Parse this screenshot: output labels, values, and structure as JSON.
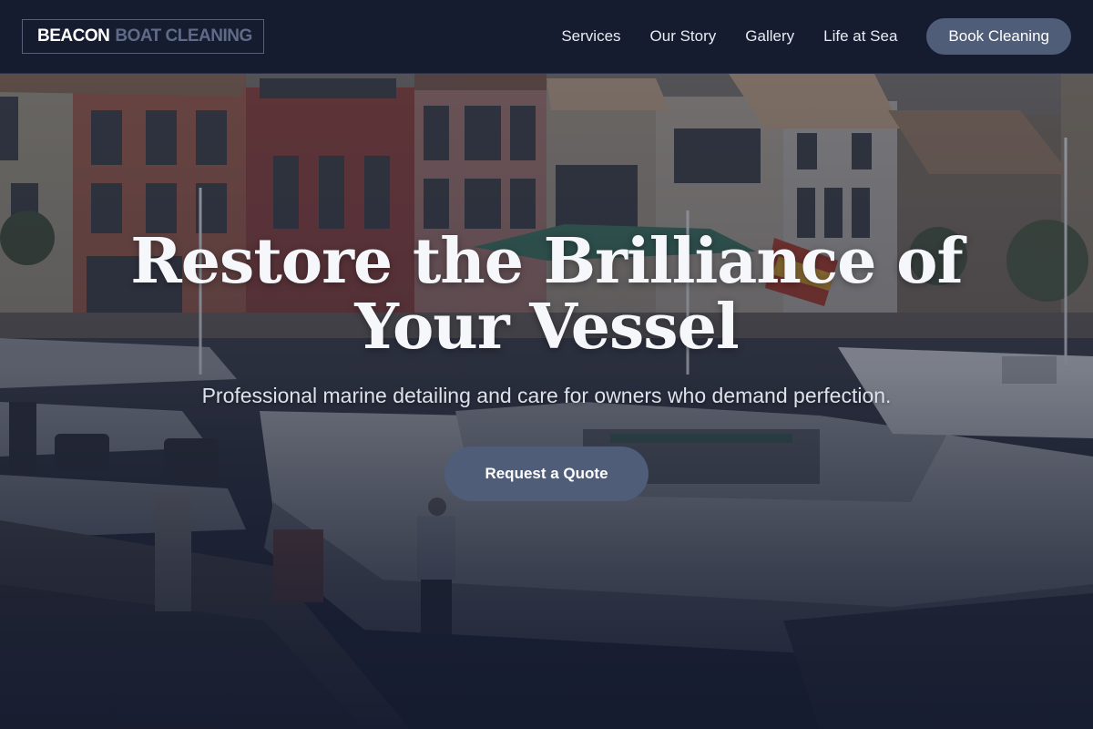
{
  "brand": {
    "name_strong": "BEACON",
    "name_soft": "BOAT CLEANING"
  },
  "nav": {
    "links": [
      "Services",
      "Our Story",
      "Gallery",
      "Life at Sea"
    ],
    "cta_label": "Book Cleaning"
  },
  "hero": {
    "title_line1": "Restore the Brilliance of",
    "title_line2": "Your Vessel",
    "subtitle": "Professional marine detailing and care for owners who demand perfection.",
    "button_label": "Request a Quote",
    "background_image": "marina-harbor-photo"
  },
  "colors": {
    "nav_bg": "#161c30",
    "accent_button": "#4f5d79",
    "page_bg": "#141a2c"
  }
}
